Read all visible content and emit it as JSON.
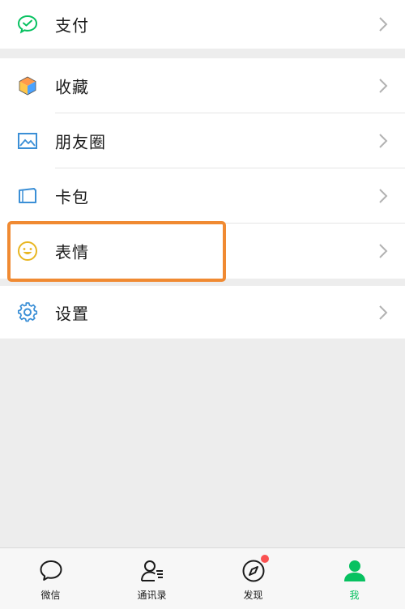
{
  "menu": {
    "pay": {
      "label": "支付",
      "icon": "wechat-pay-icon"
    },
    "favorites": {
      "label": "收藏",
      "icon": "favorites-cube-icon"
    },
    "moments": {
      "label": "朋友圈",
      "icon": "album-icon"
    },
    "cards": {
      "label": "卡包",
      "icon": "card-icon"
    },
    "stickers": {
      "label": "表情",
      "icon": "smiley-icon"
    },
    "settings": {
      "label": "设置",
      "icon": "gear-icon"
    }
  },
  "tabbar": {
    "items": [
      {
        "label": "微信",
        "icon": "chat-bubble-icon"
      },
      {
        "label": "通讯录",
        "icon": "contacts-icon"
      },
      {
        "label": "发现",
        "icon": "compass-icon",
        "badge": true
      },
      {
        "label": "我",
        "icon": "person-icon",
        "active": true
      }
    ]
  },
  "colors": {
    "accent": "#07c160",
    "highlight": "#f08a32",
    "badge": "#fa5151",
    "background": "#ededed"
  }
}
